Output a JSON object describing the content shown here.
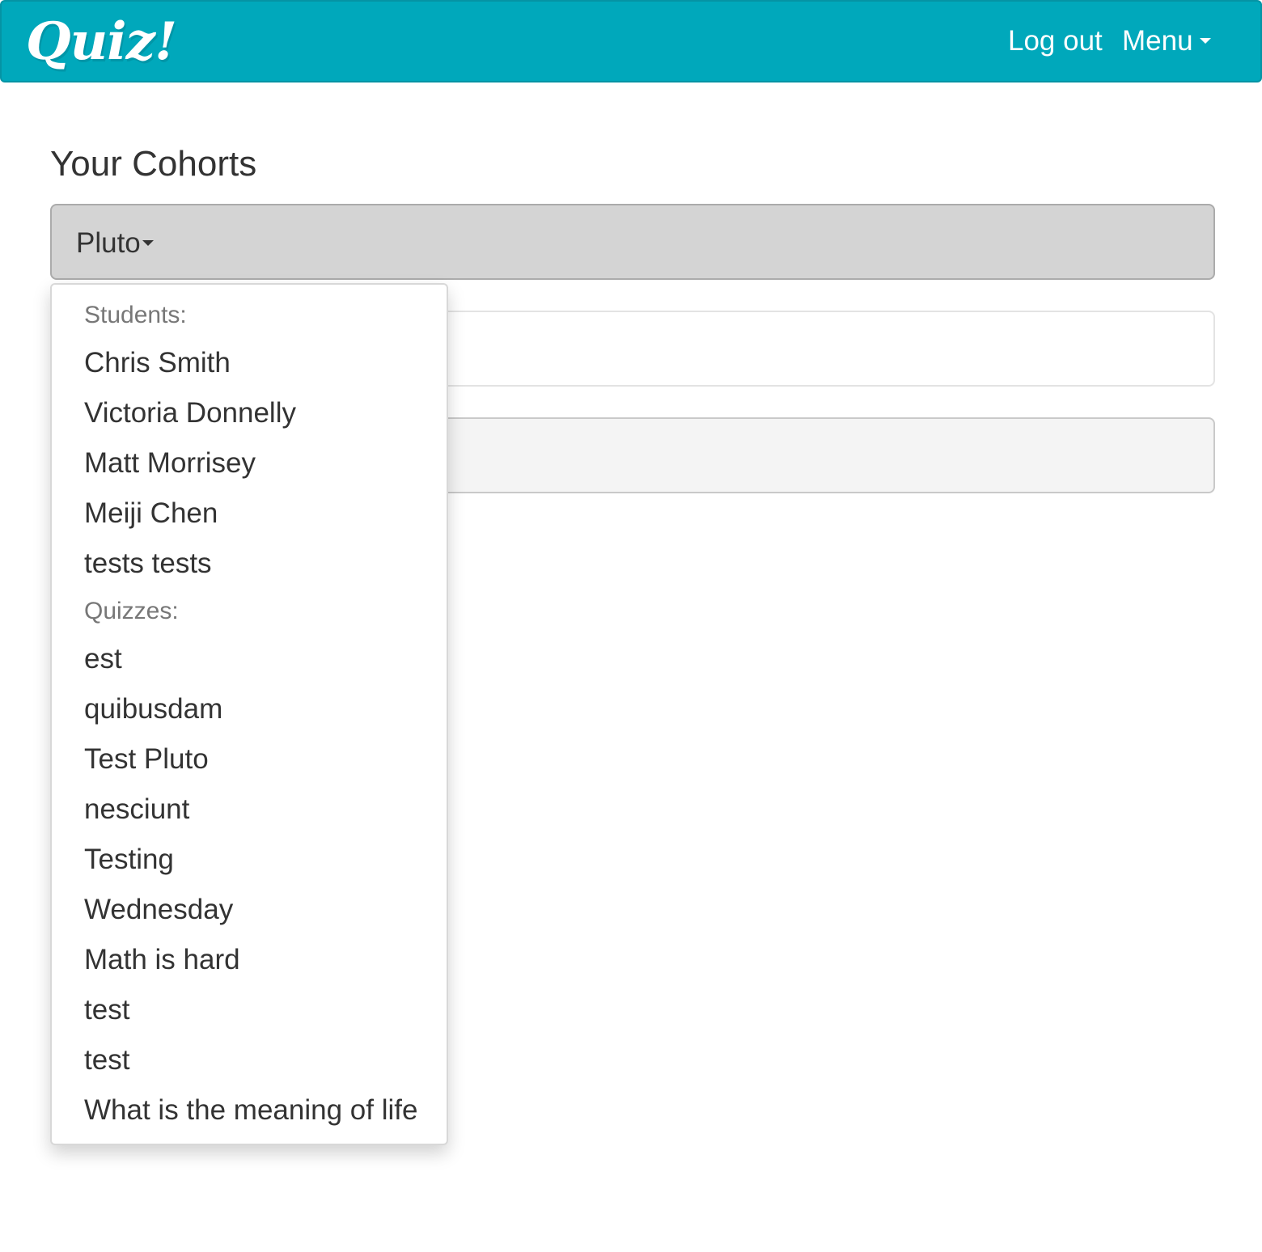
{
  "navbar": {
    "brand": "Quiz!",
    "logout_label": "Log out",
    "menu_label": "Menu",
    "background": "#00a8bb"
  },
  "page_title": "Your Cohorts",
  "cohort_dropdown": {
    "selected": "Pluto",
    "students_header": "Students:",
    "students": [
      "Chris Smith",
      "Victoria Donnelly",
      "Matt Morrisey",
      "Meiji Chen",
      "tests tests"
    ],
    "quizzes_header": "Quizzes:",
    "quizzes": [
      "est",
      "quibusdam",
      "Test Pluto",
      "nesciunt",
      "Testing",
      "Wednesday",
      "Math is hard",
      "test",
      "test",
      "What is the meaning of life"
    ]
  }
}
